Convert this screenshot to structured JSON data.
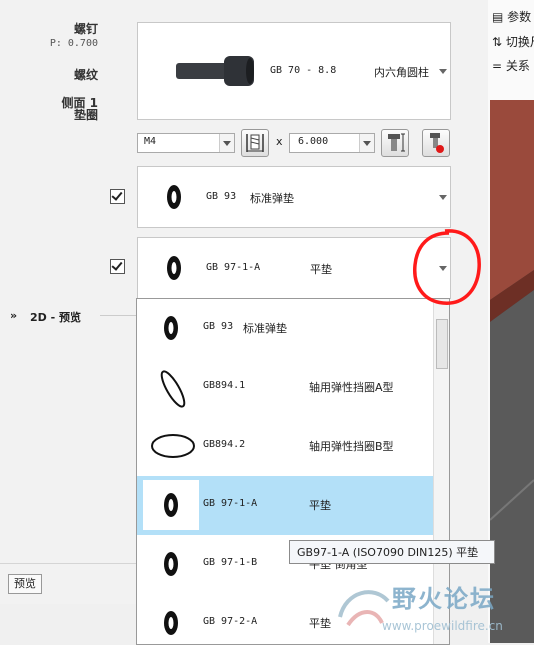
{
  "labels": {
    "screw": "螺钉",
    "pitch": "P: 0.700",
    "thread": "螺纹",
    "side1": "侧面 1",
    "washer": "垫圈"
  },
  "screw_part": {
    "code": "GB 70 - 8.8",
    "name": "内六角圆柱"
  },
  "size_combo": {
    "value": "M4"
  },
  "times": "x",
  "length_combo": {
    "value": "6.000"
  },
  "washer1": {
    "checked": true,
    "code": "GB 93",
    "name": "标准弹垫"
  },
  "washer2": {
    "checked": true,
    "code": "GB 97-1-A",
    "name": "平垫"
  },
  "preview_section": {
    "label": "2D - 预览"
  },
  "preview_button": {
    "label": "预览"
  },
  "dropdown_items": [
    {
      "code": "GB 93",
      "name": "标准弹垫",
      "selected": false,
      "icon": "spring-washer"
    },
    {
      "code": "GB894.1",
      "name": "轴用弹性挡圈A型",
      "selected": false,
      "icon": "retaining-ring-a"
    },
    {
      "code": "GB894.2",
      "name": "轴用弹性挡圈B型",
      "selected": false,
      "icon": "retaining-ring-b"
    },
    {
      "code": "GB 97-1-A",
      "name": "平垫",
      "selected": true,
      "icon": "flat-washer"
    },
    {
      "code": "GB 97-1-B",
      "name": "平垫 倒角型",
      "selected": false,
      "icon": "flat-washer"
    },
    {
      "code": "GB 97-2-A",
      "name": "平垫",
      "selected": false,
      "icon": "flat-washer"
    }
  ],
  "tooltip": "GB97-1-A (ISO7090 DIN125) 平垫",
  "right_menu": [
    {
      "label": "参数"
    },
    {
      "label": "切换尺"
    },
    {
      "label": "关系"
    }
  ],
  "watermark": {
    "text": "野火论坛",
    "url": "www.proewildfire.cn"
  },
  "colors": {
    "selection": "#b3e0f8",
    "highlight_circle": "#ff1a1a",
    "scene": "#9a4a3c"
  }
}
